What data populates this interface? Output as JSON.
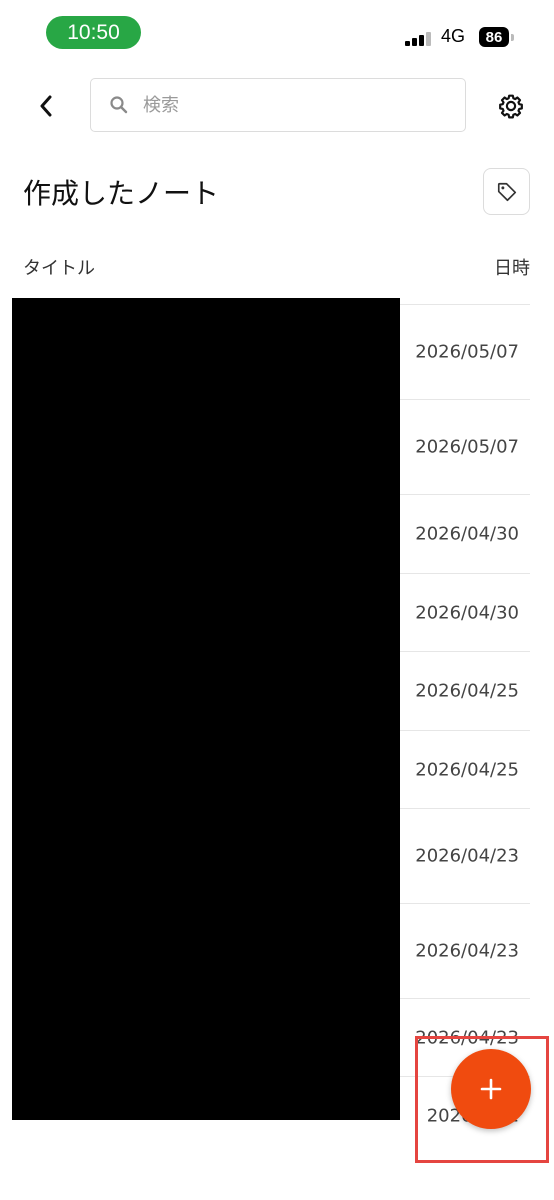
{
  "status_bar": {
    "time": "10:50",
    "network": "4G",
    "battery": "86"
  },
  "header": {
    "search_placeholder": "検索"
  },
  "page": {
    "title": "作成したノート"
  },
  "columns": {
    "title": "タイトル",
    "date": "日時"
  },
  "notes": [
    {
      "date": "2026/05/07"
    },
    {
      "date": "2026/05/07"
    },
    {
      "date": "2026/04/30"
    },
    {
      "date": "2026/04/30"
    },
    {
      "date": "2026/04/25"
    },
    {
      "date": "2026/04/25"
    },
    {
      "date": "2026/04/23"
    },
    {
      "date": "2026/04/23"
    },
    {
      "date": "2026/04/23"
    },
    {
      "date": "2026/04/1"
    }
  ],
  "colors": {
    "accent": "#f04b0f",
    "status_pill": "#28a745",
    "highlight": "#e54540"
  },
  "icons": [
    "back-chevron",
    "search",
    "gear",
    "tag",
    "plus"
  ]
}
